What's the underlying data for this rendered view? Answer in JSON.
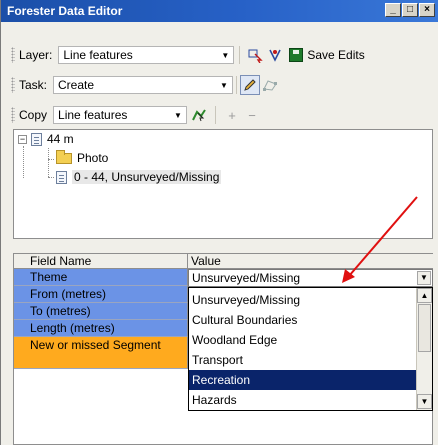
{
  "window": {
    "title": "Forester Data Editor"
  },
  "title_controls": {
    "minimize": "_",
    "restore": "□",
    "close": "×"
  },
  "toolbar_layer": {
    "label": "Layer:",
    "value": "Line features",
    "save_label": "Save Edits"
  },
  "toolbar_task": {
    "label": "Task:",
    "value": "Create"
  },
  "toolbar_copy": {
    "label": "Copy",
    "value": "Line features",
    "plus": "+",
    "minus": "−"
  },
  "tree": {
    "expander": "−",
    "root": "44 m",
    "child_folder": "Photo",
    "child_item": "0 - 44, Unsurveyed/Missing"
  },
  "grid": {
    "headers": {
      "field": "Field Name",
      "value": "Value"
    },
    "fields": [
      "Theme",
      "From (metres)",
      "To (metres)",
      "Length (metres)",
      "New or missed Segment"
    ],
    "theme_value": "Unsurveyed/Missing",
    "dropdown_options": [
      "Unsurveyed/Missing",
      "Cultural Boundaries",
      "Woodland Edge",
      "Transport",
      "Recreation",
      "Hazards"
    ],
    "selected_option": "Recreation"
  },
  "colors": {
    "title_bar": "#2761c7",
    "field_required": "#6b93e6",
    "field_highlight": "#ffaa1e",
    "selection": "#0a246a",
    "annotation_arrow": "#e01010"
  }
}
